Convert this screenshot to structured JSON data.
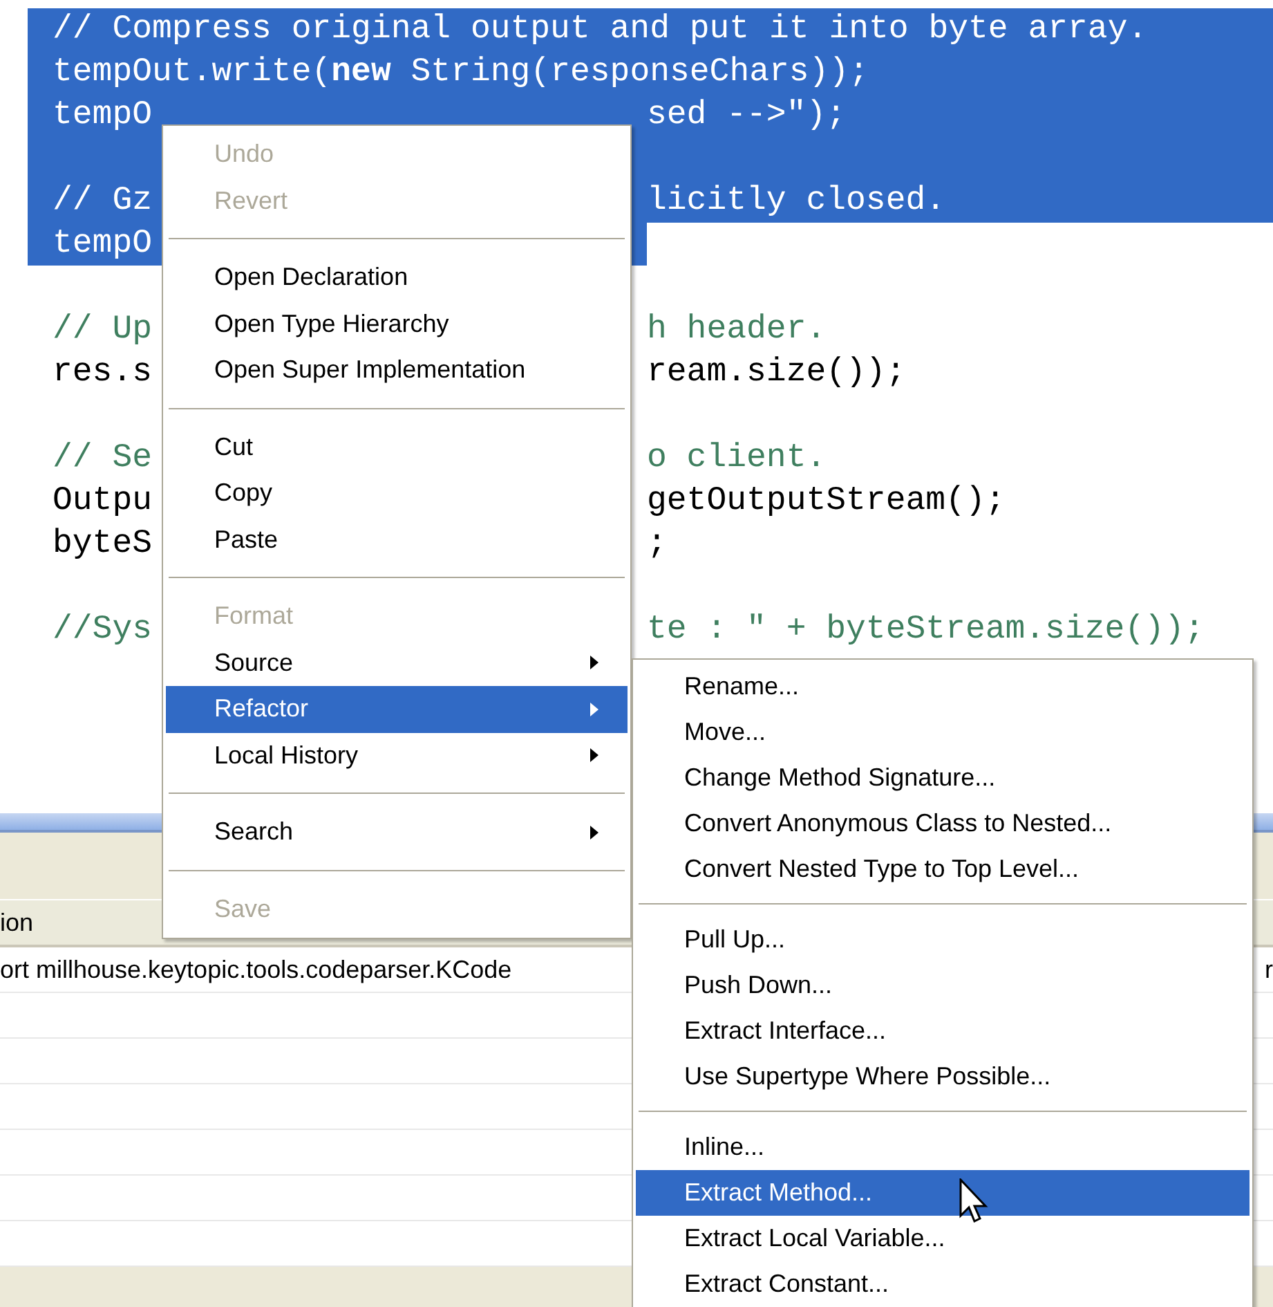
{
  "editor": {
    "lines": [
      {
        "left": "// Compress original output and put it into byte array.",
        "kind": "comment",
        "selected": true
      },
      {
        "left": "tempOut.write(**new** String(responseChars));",
        "kind": "code",
        "selected": true
      },
      {
        "left": "tempO",
        "right": "sed -->\");",
        "kind": "code",
        "selected": true
      },
      {
        "selected": true
      },
      {
        "left": "// Gz",
        "right": "licitly closed.",
        "kind": "comment",
        "selected": true
      },
      {
        "left": "tempO",
        "kind": "code",
        "selected": true
      },
      {
        "selected": false
      },
      {
        "left": "// Up",
        "right": "h header.",
        "kind": "comment",
        "selected": false
      },
      {
        "left": "res.s",
        "right": "ream.size());",
        "kind": "code",
        "selected": false
      },
      {
        "selected": false
      },
      {
        "left": "// Se",
        "right": "o client.",
        "kind": "comment",
        "selected": false
      },
      {
        "left": "Outpu",
        "right": "getOutputStream();",
        "kind": "code",
        "selected": false
      },
      {
        "left": "byteS",
        "right": ";",
        "kind": "code",
        "selected": false
      },
      {
        "selected": false
      },
      {
        "left": "//Sys",
        "right": "te : \" + byteStream.size());",
        "kind": "comment",
        "selected": false
      }
    ]
  },
  "bottom_panel": {
    "column_header": "ion",
    "rows": [
      {
        "column_1": "ort millhouse.keytopic.tools.codeparser.KCode",
        "column_2": "r"
      },
      {},
      {},
      {},
      {},
      {},
      {}
    ]
  },
  "context_menu": {
    "items": [
      {
        "kind": "item",
        "label": "Undo",
        "disabled": true,
        "submenu": false,
        "selected": false
      },
      {
        "kind": "item",
        "label": "Revert",
        "disabled": true,
        "submenu": false,
        "selected": false
      },
      {
        "kind": "separator"
      },
      {
        "kind": "item",
        "label": "Open Declaration",
        "disabled": false,
        "submenu": false,
        "selected": false
      },
      {
        "kind": "item",
        "label": "Open Type Hierarchy",
        "disabled": false,
        "submenu": false,
        "selected": false
      },
      {
        "kind": "item",
        "label": "Open Super Implementation",
        "disabled": false,
        "submenu": false,
        "selected": false
      },
      {
        "kind": "separator"
      },
      {
        "kind": "item",
        "label": "Cut",
        "disabled": false,
        "submenu": false,
        "selected": false
      },
      {
        "kind": "item",
        "label": "Copy",
        "disabled": false,
        "submenu": false,
        "selected": false
      },
      {
        "kind": "item",
        "label": "Paste",
        "disabled": false,
        "submenu": false,
        "selected": false
      },
      {
        "kind": "separator"
      },
      {
        "kind": "item",
        "label": "Format",
        "disabled": true,
        "submenu": false,
        "selected": false
      },
      {
        "kind": "item",
        "label": "Source",
        "disabled": false,
        "submenu": true,
        "selected": false
      },
      {
        "kind": "item",
        "label": "Refactor",
        "disabled": false,
        "submenu": true,
        "selected": true
      },
      {
        "kind": "item",
        "label": "Local History",
        "disabled": false,
        "submenu": true,
        "selected": false
      },
      {
        "kind": "separator"
      },
      {
        "kind": "item",
        "label": "Search",
        "disabled": false,
        "submenu": true,
        "selected": false
      },
      {
        "kind": "separator"
      },
      {
        "kind": "item",
        "label": "Save",
        "disabled": true,
        "submenu": false,
        "selected": false
      }
    ]
  },
  "refactor_menu": {
    "items": [
      {
        "kind": "item",
        "label": "Rename...",
        "selected": false
      },
      {
        "kind": "item",
        "label": "Move...",
        "selected": false
      },
      {
        "kind": "item",
        "label": "Change Method Signature...",
        "selected": false
      },
      {
        "kind": "item",
        "label": "Convert Anonymous Class to Nested...",
        "selected": false
      },
      {
        "kind": "item",
        "label": "Convert Nested Type to Top Level...",
        "selected": false
      },
      {
        "kind": "separator"
      },
      {
        "kind": "item",
        "label": "Pull Up...",
        "selected": false
      },
      {
        "kind": "item",
        "label": "Push Down...",
        "selected": false
      },
      {
        "kind": "item",
        "label": "Extract Interface...",
        "selected": false
      },
      {
        "kind": "item",
        "label": "Use Supertype Where Possible...",
        "selected": false
      },
      {
        "kind": "separator"
      },
      {
        "kind": "item",
        "label": "Inline...",
        "selected": false
      },
      {
        "kind": "item",
        "label": "Extract Method...",
        "selected": true
      },
      {
        "kind": "item",
        "label": "Extract Local Variable...",
        "selected": false
      },
      {
        "kind": "item",
        "label": "Extract Constant...",
        "selected": false
      }
    ]
  }
}
